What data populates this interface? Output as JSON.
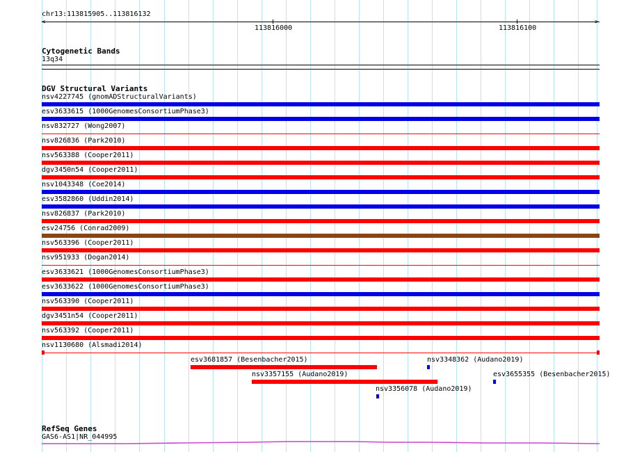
{
  "colors": {
    "grid": "#b8e6f0",
    "blue": "#0000e6",
    "red": "#ff0000",
    "brown": "#8b4513",
    "thin_red": "#ff0000",
    "refseq": "#cc44cc"
  },
  "ruler": {
    "region": "chr13:113815905..113816132",
    "tick_labels": [
      "113816000",
      "113816100"
    ]
  },
  "cytoband": {
    "header": "Cytogenetic Bands",
    "band": "13q34"
  },
  "dgv": {
    "header": "DGV Structural Variants",
    "tracks": [
      {
        "label": "nsv4227745 (gnomADStructuralVariants)",
        "color": "blue",
        "style": "thick"
      },
      {
        "label": "esv3633615 (1000GenomesConsortiumPhase3)",
        "color": "blue",
        "style": "thick"
      },
      {
        "label": "nsv832727 (Wong2007)",
        "color": "red",
        "style": "thin"
      },
      {
        "label": "nsv826836 (Park2010)",
        "color": "red",
        "style": "thick"
      },
      {
        "label": "nsv563388 (Cooper2011)",
        "color": "red",
        "style": "thick"
      },
      {
        "label": "dgv3450n54 (Cooper2011)",
        "color": "red",
        "style": "thick"
      },
      {
        "label": "nsv1043348 (Coe2014)",
        "color": "blue",
        "style": "thick"
      },
      {
        "label": "esv3582860 (Uddin2014)",
        "color": "blue",
        "style": "thick"
      },
      {
        "label": "nsv826837 (Park2010)",
        "color": "red",
        "style": "thick"
      },
      {
        "label": "esv24756 (Conrad2009)",
        "color": "brown",
        "style": "thick"
      },
      {
        "label": "nsv563396 (Cooper2011)",
        "color": "red",
        "style": "thick"
      },
      {
        "label": "nsv951933 (Dogan2014)",
        "color": "red",
        "style": "thin"
      },
      {
        "label": "esv3633621 (1000GenomesConsortiumPhase3)",
        "color": "red",
        "style": "thick"
      },
      {
        "label": "esv3633622 (1000GenomesConsortiumPhase3)",
        "color": "blue",
        "style": "thick"
      },
      {
        "label": "nsv563390 (Cooper2011)",
        "color": "red",
        "style": "thick"
      },
      {
        "label": "dgv3451n54 (Cooper2011)",
        "color": "red",
        "style": "thick"
      },
      {
        "label": "nsv563392 (Cooper2011)",
        "color": "red",
        "style": "thick"
      },
      {
        "label": "nsv1130680 (Alsmadi2014)",
        "color": "red",
        "style": "thin-capped"
      }
    ],
    "small_features": [
      {
        "label": "esv3681857 (Besenbacher2015)",
        "color": "red"
      },
      {
        "label": "nsv3348362 (Audano2019)",
        "color": "blue"
      },
      {
        "label": "nsv3357155 (Audano2019)",
        "color": "red"
      },
      {
        "label": "esv3655355 (Besenbacher2015)",
        "color": "blue"
      },
      {
        "label": "nsv3356078 (Audano2019)",
        "color": "blue"
      }
    ]
  },
  "refseq": {
    "header": "RefSeq Genes",
    "gene": "GAS6-AS1|NR_044995"
  }
}
